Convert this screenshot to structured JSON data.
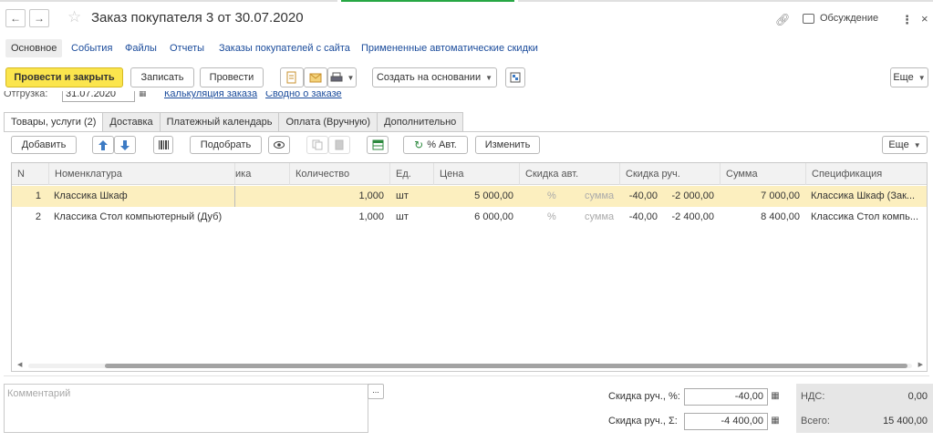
{
  "window": {
    "title": "Заказ покупателя 3 от 30.07.2020",
    "discussion_label": "Обсуждение",
    "accent_green": "#27a744",
    "accent_yellow": "#fbe54d"
  },
  "subnav": {
    "items": [
      "Основное",
      "События",
      "Файлы",
      "Отчеты",
      "Заказы покупателей с сайта",
      "Примененные автоматические скидки"
    ]
  },
  "toolbar": {
    "post_close": "Провести и закрыть",
    "save": "Записать",
    "post": "Провести",
    "create_based": "Создать на основании",
    "more": "Еще"
  },
  "ghost": {
    "shipment_label": "Отгрузка:",
    "shipment_date": "31.07.2020",
    "link_calc": "Калькуляция заказа",
    "link_summary": "Сводно о заказе"
  },
  "tabs": [
    "Товары, услуги (2)",
    "Доставка",
    "Платежный календарь",
    "Оплата (Вручную)",
    "Дополнительно"
  ],
  "table_toolbar": {
    "add": "Добавить",
    "pick": "Подобрать",
    "auto_pct": "% Авт.",
    "change": "Изменить",
    "more": "Еще"
  },
  "grid": {
    "headers": {
      "n": "N",
      "item": "Номенклатура",
      "partial": "ика",
      "qty": "Количество",
      "unit": "Ед.",
      "price": "Цена",
      "disc_auto": "Скидка авт.",
      "disc_manual": "Скидка руч.",
      "sum": "Сумма",
      "spec": "Спецификация"
    },
    "rows": [
      {
        "n": "1",
        "item": "Классика Шкаф",
        "qty": "1,000",
        "unit": "шт",
        "price": "5 000,00",
        "auto_pct": "%",
        "auto_sum": "сумма",
        "manual_pct": "-40,00",
        "manual_sum": "-2 000,00",
        "sum": "7 000,00",
        "spec": "Классика Шкаф  (Зак..."
      },
      {
        "n": "2",
        "item": "Классика Стол компьютерный (Дуб)",
        "qty": "1,000",
        "unit": "шт",
        "price": "6 000,00",
        "auto_pct": "%",
        "auto_sum": "сумма",
        "manual_pct": "-40,00",
        "manual_sum": "-2 400,00",
        "sum": "8 400,00",
        "spec": "Классика Стол компь..."
      }
    ]
  },
  "footer": {
    "comment_placeholder": "Комментарий",
    "comment_btn": "...",
    "disc_pct_label": "Скидка руч., %:",
    "disc_pct_value": "-40,00",
    "disc_sum_label": "Скидка руч., Σ:",
    "disc_sum_value": "-4 400,00",
    "vat_label": "НДС:",
    "vat_value": "0,00",
    "total_label": "Всего:",
    "total_value": "15 400,00"
  }
}
